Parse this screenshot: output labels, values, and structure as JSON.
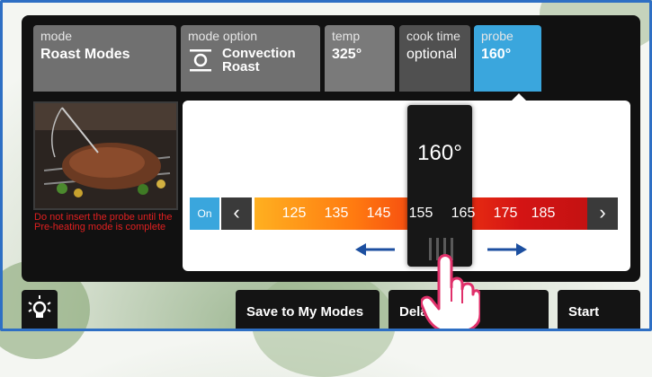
{
  "tabs": [
    {
      "label": "mode",
      "value": "Roast Modes"
    },
    {
      "label": "mode option",
      "value": "Convection Roast"
    },
    {
      "label": "temp",
      "value": "325°"
    },
    {
      "label": "cook time",
      "value": "optional"
    },
    {
      "label": "probe",
      "value": "160°"
    }
  ],
  "warning": "Do not insert the probe until the Pre-heating mode is complete",
  "probe_control": {
    "on_label": "On",
    "current": "160°",
    "ticks": [
      "125",
      "135",
      "145",
      "155",
      "165",
      "175",
      "185"
    ]
  },
  "bottom": {
    "save": "Save to My Modes",
    "delay": "Delay",
    "start": "Start"
  },
  "colors": {
    "accent": "#3aa6dd",
    "panel": "#111111",
    "warning": "#e02020"
  }
}
